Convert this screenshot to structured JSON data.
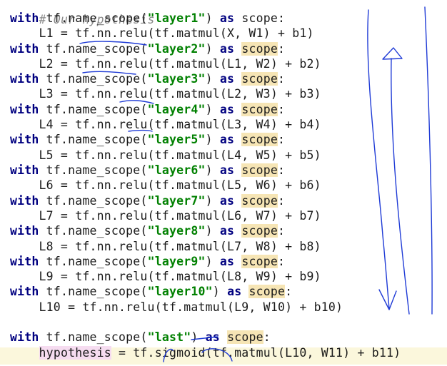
{
  "code": {
    "comment": "# Our hypothesis",
    "keyword_with": "with",
    "keyword_as": "as",
    "fn_name_scope": "tf.name_scope(",
    "scope_var": "scope",
    "layers": [
      {
        "name": "\"layer1\"",
        "body": "L1 = tf.nn.relu(tf.matmul(X, W1) + b1)",
        "scope_highlight": false
      },
      {
        "name": "\"layer2\"",
        "body": "L2 = tf.nn.relu(tf.matmul(L1, W2) + b2)",
        "scope_highlight": true
      },
      {
        "name": "\"layer3\"",
        "body": "L3 = tf.nn.relu(tf.matmul(L2, W3) + b3)",
        "scope_highlight": true
      },
      {
        "name": "\"layer4\"",
        "body": "L4 = tf.nn.relu(tf.matmul(L3, W4) + b4)",
        "scope_highlight": true
      },
      {
        "name": "\"layer5\"",
        "body": "L5 = tf.nn.relu(tf.matmul(L4, W5) + b5)",
        "scope_highlight": true
      },
      {
        "name": "\"layer6\"",
        "body": "L6 = tf.nn.relu(tf.matmul(L5, W6) + b6)",
        "scope_highlight": true
      },
      {
        "name": "\"layer7\"",
        "body": "L7 = tf.nn.relu(tf.matmul(L6, W7) + b7)",
        "scope_highlight": true
      },
      {
        "name": "\"layer8\"",
        "body": "L8 = tf.nn.relu(tf.matmul(L7, W8) + b8)",
        "scope_highlight": true
      },
      {
        "name": "\"layer9\"",
        "body": "L9 = tf.nn.relu(tf.matmul(L8, W9) + b9)",
        "scope_highlight": true
      },
      {
        "name": "\"layer10\"",
        "body": "L10 = tf.nn.relu(tf.matmul(L9, W10) + b10)",
        "scope_highlight": true
      }
    ],
    "last": {
      "name": "\"last\"",
      "var": "hypothesis",
      "body": " = tf.sigmoid(tf.matmul(L10, W11) + b11)"
    }
  },
  "colors": {
    "keyword": "#000080",
    "string": "#008000",
    "comment": "#8a8a8a",
    "scope_highlight": "#f6e5b5",
    "current_line": "#fbf7dc",
    "annotation_ink": "#1f3bd6"
  }
}
